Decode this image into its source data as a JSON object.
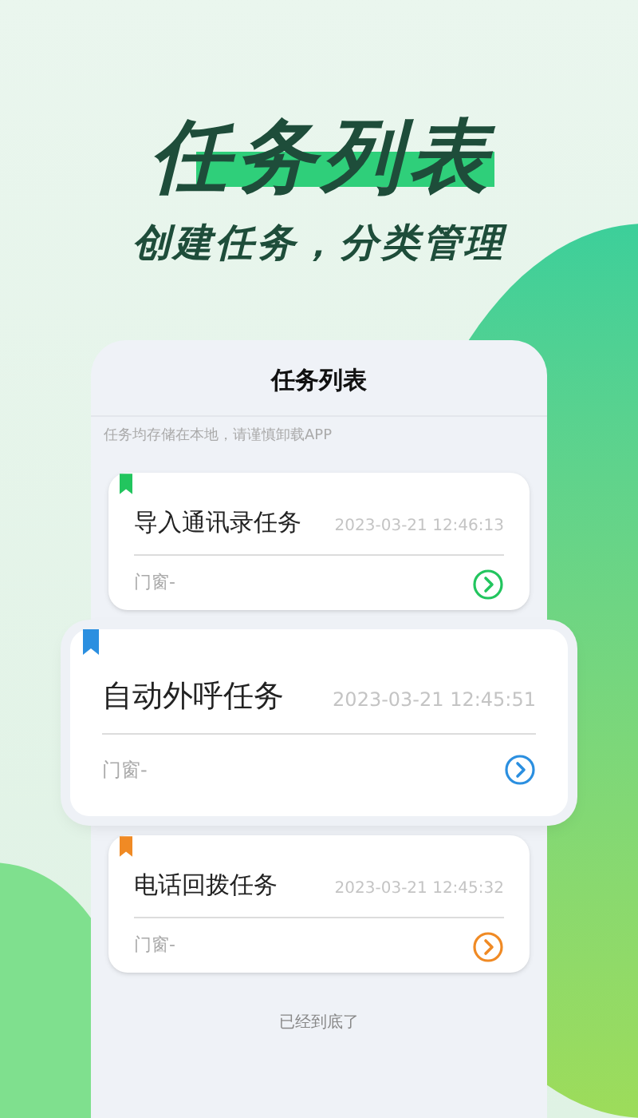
{
  "headline": {
    "title": "任务列表",
    "subtitle": "创建任务，分类管理"
  },
  "screen": {
    "title": "任务列表",
    "notice": "任务均存储在本地，请谨慎卸载APP",
    "tasks": [
      {
        "name": "导入通讯录任务",
        "time": "2023-03-21 12:46:13",
        "note": "门窗-",
        "color": "#22c55e",
        "highlighted": false
      },
      {
        "name": "自动外呼任务",
        "time": "2023-03-21 12:45:51",
        "note": "门窗-",
        "color": "#2b8fe0",
        "highlighted": true
      },
      {
        "name": "电话回拨任务",
        "time": "2023-03-21 12:45:32",
        "note": "门窗-",
        "color": "#f08a24",
        "highlighted": false
      }
    ],
    "footer": "已经到底了"
  }
}
